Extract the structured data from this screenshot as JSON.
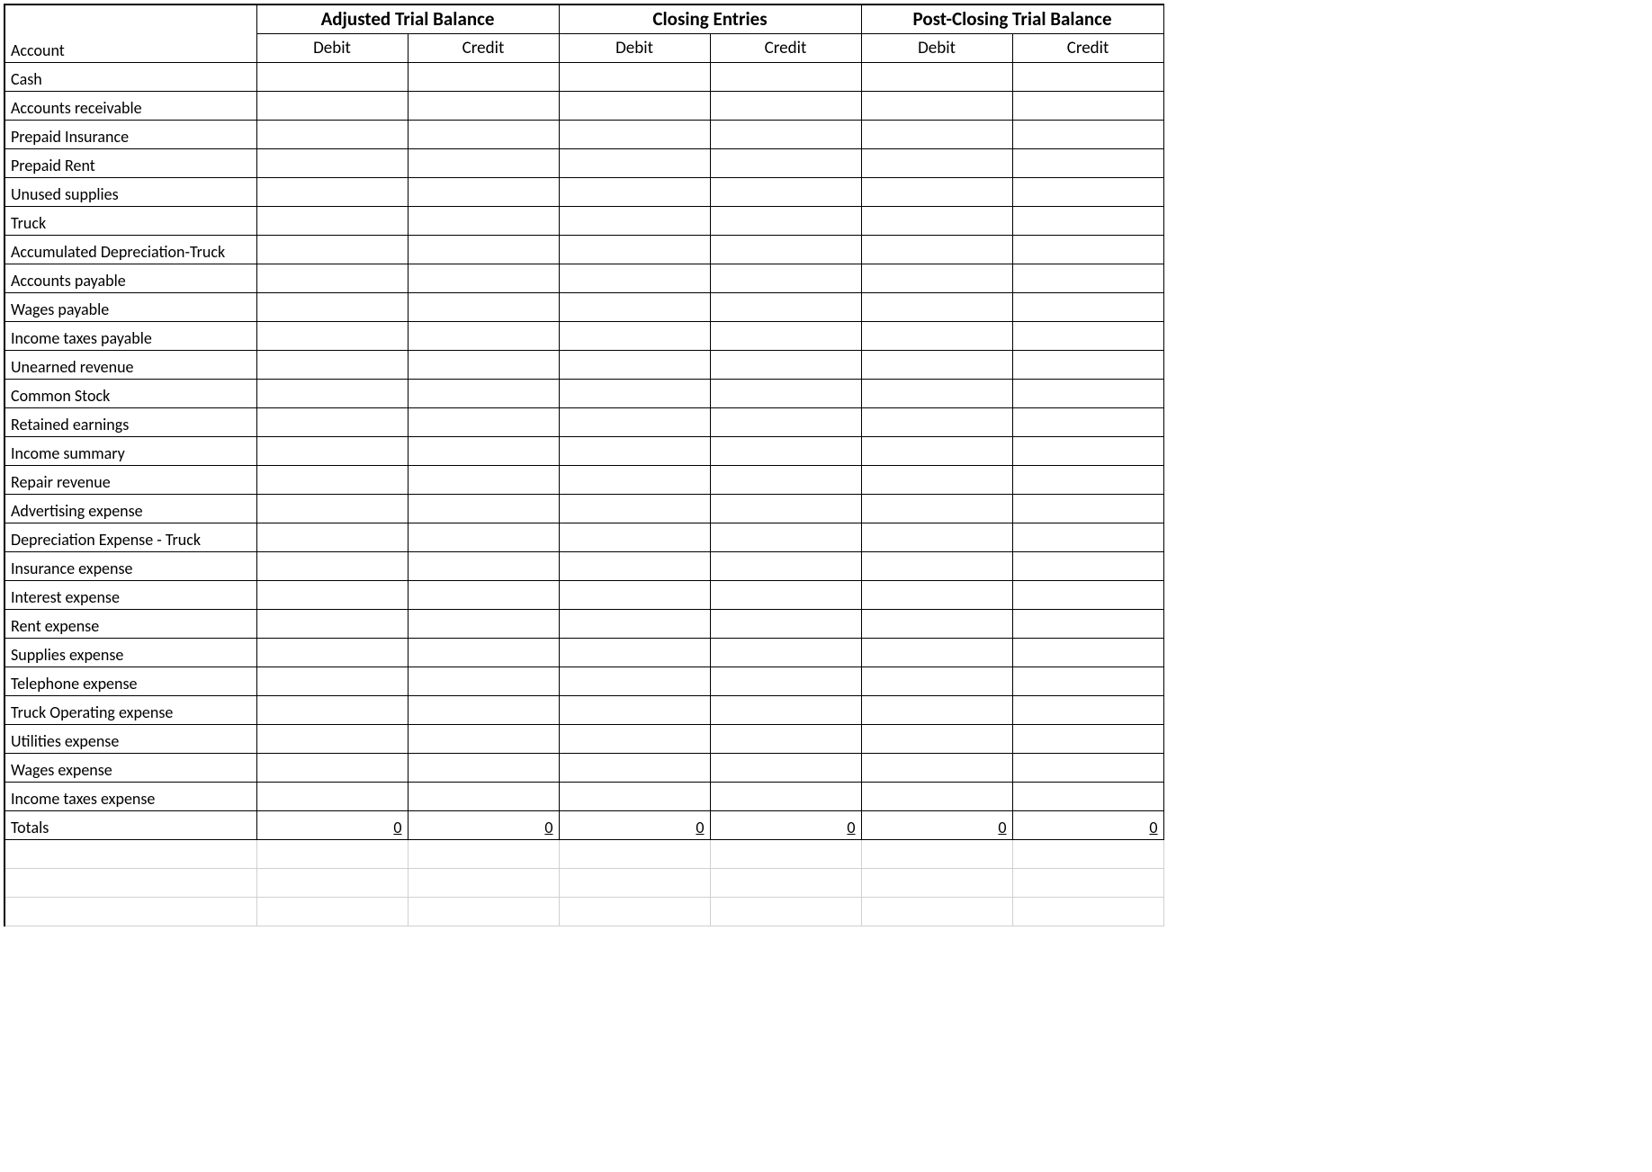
{
  "header": {
    "account_label": "Account",
    "groups": [
      {
        "label": "Adjusted Trial Balance",
        "debit": "Debit",
        "credit": "Credit"
      },
      {
        "label": "Closing Entries",
        "debit": "Debit",
        "credit": "Credit"
      },
      {
        "label": "Post-Closing Trial Balance",
        "debit": "Debit",
        "credit": "Credit"
      }
    ]
  },
  "rows": [
    {
      "account": "Cash",
      "atb_d": "",
      "atb_c": "",
      "ce_d": "",
      "ce_c": "",
      "pc_d": "",
      "pc_c": ""
    },
    {
      "account": "Accounts receivable",
      "atb_d": "",
      "atb_c": "",
      "ce_d": "",
      "ce_c": "",
      "pc_d": "",
      "pc_c": ""
    },
    {
      "account": "Prepaid Insurance",
      "atb_d": "",
      "atb_c": "",
      "ce_d": "",
      "ce_c": "",
      "pc_d": "",
      "pc_c": ""
    },
    {
      "account": "Prepaid Rent",
      "atb_d": "",
      "atb_c": "",
      "ce_d": "",
      "ce_c": "",
      "pc_d": "",
      "pc_c": ""
    },
    {
      "account": "Unused supplies",
      "atb_d": "",
      "atb_c": "",
      "ce_d": "",
      "ce_c": "",
      "pc_d": "",
      "pc_c": ""
    },
    {
      "account": "Truck",
      "atb_d": "",
      "atb_c": "",
      "ce_d": "",
      "ce_c": "",
      "pc_d": "",
      "pc_c": ""
    },
    {
      "account": "Accumulated Depreciation-Truck",
      "atb_d": "",
      "atb_c": "",
      "ce_d": "",
      "ce_c": "",
      "pc_d": "",
      "pc_c": ""
    },
    {
      "account": "Accounts payable",
      "atb_d": "",
      "atb_c": "",
      "ce_d": "",
      "ce_c": "",
      "pc_d": "",
      "pc_c": ""
    },
    {
      "account": "Wages payable",
      "atb_d": "",
      "atb_c": "",
      "ce_d": "",
      "ce_c": "",
      "pc_d": "",
      "pc_c": ""
    },
    {
      "account": "Income taxes payable",
      "atb_d": "",
      "atb_c": "",
      "ce_d": "",
      "ce_c": "",
      "pc_d": "",
      "pc_c": ""
    },
    {
      "account": "Unearned revenue",
      "atb_d": "",
      "atb_c": "",
      "ce_d": "",
      "ce_c": "",
      "pc_d": "",
      "pc_c": ""
    },
    {
      "account": "Common Stock",
      "atb_d": "",
      "atb_c": "",
      "ce_d": "",
      "ce_c": "",
      "pc_d": "",
      "pc_c": ""
    },
    {
      "account": "Retained earnings",
      "atb_d": "",
      "atb_c": "",
      "ce_d": "",
      "ce_c": "",
      "pc_d": "",
      "pc_c": ""
    },
    {
      "account": "Income summary",
      "atb_d": "",
      "atb_c": "",
      "ce_d": "",
      "ce_c": "",
      "pc_d": "",
      "pc_c": ""
    },
    {
      "account": "Repair revenue",
      "atb_d": "",
      "atb_c": "",
      "ce_d": "",
      "ce_c": "",
      "pc_d": "",
      "pc_c": ""
    },
    {
      "account": "Advertising expense",
      "atb_d": "",
      "atb_c": "",
      "ce_d": "",
      "ce_c": "",
      "pc_d": "",
      "pc_c": ""
    },
    {
      "account": "Depreciation Expense - Truck",
      "atb_d": "",
      "atb_c": "",
      "ce_d": "",
      "ce_c": "",
      "pc_d": "",
      "pc_c": ""
    },
    {
      "account": "Insurance expense",
      "atb_d": "",
      "atb_c": "",
      "ce_d": "",
      "ce_c": "",
      "pc_d": "",
      "pc_c": ""
    },
    {
      "account": "Interest expense",
      "atb_d": "",
      "atb_c": "",
      "ce_d": "",
      "ce_c": "",
      "pc_d": "",
      "pc_c": ""
    },
    {
      "account": "Rent expense",
      "atb_d": "",
      "atb_c": "",
      "ce_d": "",
      "ce_c": "",
      "pc_d": "",
      "pc_c": ""
    },
    {
      "account": "Supplies expense",
      "atb_d": "",
      "atb_c": "",
      "ce_d": "",
      "ce_c": "",
      "pc_d": "",
      "pc_c": ""
    },
    {
      "account": "Telephone expense",
      "atb_d": "",
      "atb_c": "",
      "ce_d": "",
      "ce_c": "",
      "pc_d": "",
      "pc_c": ""
    },
    {
      "account": "Truck Operating expense",
      "atb_d": "",
      "atb_c": "",
      "ce_d": "",
      "ce_c": "",
      "pc_d": "",
      "pc_c": ""
    },
    {
      "account": "Utilities expense",
      "atb_d": "",
      "atb_c": "",
      "ce_d": "",
      "ce_c": "",
      "pc_d": "",
      "pc_c": ""
    },
    {
      "account": "Wages expense",
      "atb_d": "",
      "atb_c": "",
      "ce_d": "",
      "ce_c": "",
      "pc_d": "",
      "pc_c": ""
    },
    {
      "account": "Income taxes expense",
      "atb_d": "",
      "atb_c": "",
      "ce_d": "",
      "ce_c": "",
      "pc_d": "",
      "pc_c": ""
    }
  ],
  "totals": {
    "label": "Totals",
    "atb_d": "0",
    "atb_c": "0",
    "ce_d": "0",
    "ce_c": "0",
    "pc_d": "0",
    "pc_c": "0"
  },
  "chart_data": {
    "type": "table",
    "title": "Trial Balance Worksheet",
    "columns": [
      "Account",
      "Adjusted Trial Balance Debit",
      "Adjusted Trial Balance Credit",
      "Closing Entries Debit",
      "Closing Entries Credit",
      "Post-Closing Trial Balance Debit",
      "Post-Closing Trial Balance Credit"
    ],
    "rows": [
      [
        "Cash",
        "",
        "",
        "",
        "",
        "",
        ""
      ],
      [
        "Accounts receivable",
        "",
        "",
        "",
        "",
        "",
        ""
      ],
      [
        "Prepaid Insurance",
        "",
        "",
        "",
        "",
        "",
        ""
      ],
      [
        "Prepaid Rent",
        "",
        "",
        "",
        "",
        "",
        ""
      ],
      [
        "Unused supplies",
        "",
        "",
        "",
        "",
        "",
        ""
      ],
      [
        "Truck",
        "",
        "",
        "",
        "",
        "",
        ""
      ],
      [
        "Accumulated Depreciation-Truck",
        "",
        "",
        "",
        "",
        "",
        ""
      ],
      [
        "Accounts payable",
        "",
        "",
        "",
        "",
        "",
        ""
      ],
      [
        "Wages payable",
        "",
        "",
        "",
        "",
        "",
        ""
      ],
      [
        "Income taxes payable",
        "",
        "",
        "",
        "",
        "",
        ""
      ],
      [
        "Unearned revenue",
        "",
        "",
        "",
        "",
        "",
        ""
      ],
      [
        "Common Stock",
        "",
        "",
        "",
        "",
        "",
        ""
      ],
      [
        "Retained earnings",
        "",
        "",
        "",
        "",
        "",
        ""
      ],
      [
        "Income summary",
        "",
        "",
        "",
        "",
        "",
        ""
      ],
      [
        "Repair revenue",
        "",
        "",
        "",
        "",
        "",
        ""
      ],
      [
        "Advertising expense",
        "",
        "",
        "",
        "",
        "",
        ""
      ],
      [
        "Depreciation Expense - Truck",
        "",
        "",
        "",
        "",
        "",
        ""
      ],
      [
        "Insurance expense",
        "",
        "",
        "",
        "",
        "",
        ""
      ],
      [
        "Interest expense",
        "",
        "",
        "",
        "",
        "",
        ""
      ],
      [
        "Rent expense",
        "",
        "",
        "",
        "",
        "",
        ""
      ],
      [
        "Supplies expense",
        "",
        "",
        "",
        "",
        "",
        ""
      ],
      [
        "Telephone expense",
        "",
        "",
        "",
        "",
        "",
        ""
      ],
      [
        "Truck Operating expense",
        "",
        "",
        "",
        "",
        "",
        ""
      ],
      [
        "Utilities expense",
        "",
        "",
        "",
        "",
        "",
        ""
      ],
      [
        "Wages expense",
        "",
        "",
        "",
        "",
        "",
        ""
      ],
      [
        "Income taxes expense",
        "",
        "",
        "",
        "",
        "",
        ""
      ],
      [
        "Totals",
        0,
        0,
        0,
        0,
        0,
        0
      ]
    ]
  }
}
